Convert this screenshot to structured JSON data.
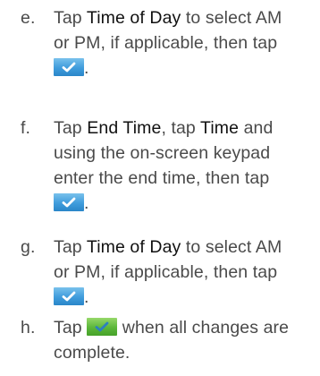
{
  "steps": [
    {
      "letter": "e.",
      "lines": [
        {
          "t1": "Tap ",
          "kw": "Time of Day",
          "t2": " to select AM"
        },
        {
          "text": "or PM, if applicable, then tap"
        },
        {
          "icon": "blue-check-button-icon",
          "after": "."
        }
      ]
    },
    {
      "letter": "f.",
      "lines": [
        {
          "t1": "Tap ",
          "kw1": "End Time",
          "t2": ", tap ",
          "kw2": "Time",
          "t3": " and"
        },
        {
          "text": "using the on-screen keypad"
        },
        {
          "text": "enter the end time, then tap"
        },
        {
          "icon": "blue-check-button-icon",
          "after": "."
        }
      ]
    },
    {
      "letter": "g.",
      "lines": [
        {
          "t1": "Tap ",
          "kw": "Time of Day",
          "t2": " to select AM"
        },
        {
          "text": "or PM, if applicable, then tap"
        },
        {
          "icon": "blue-check-button-icon",
          "after": "."
        }
      ]
    },
    {
      "letter": "h.",
      "lines": [
        {
          "t1": "Tap ",
          "icon": "green-check-button-icon",
          "t2": " when all changes are"
        },
        {
          "text": "complete."
        }
      ]
    }
  ]
}
